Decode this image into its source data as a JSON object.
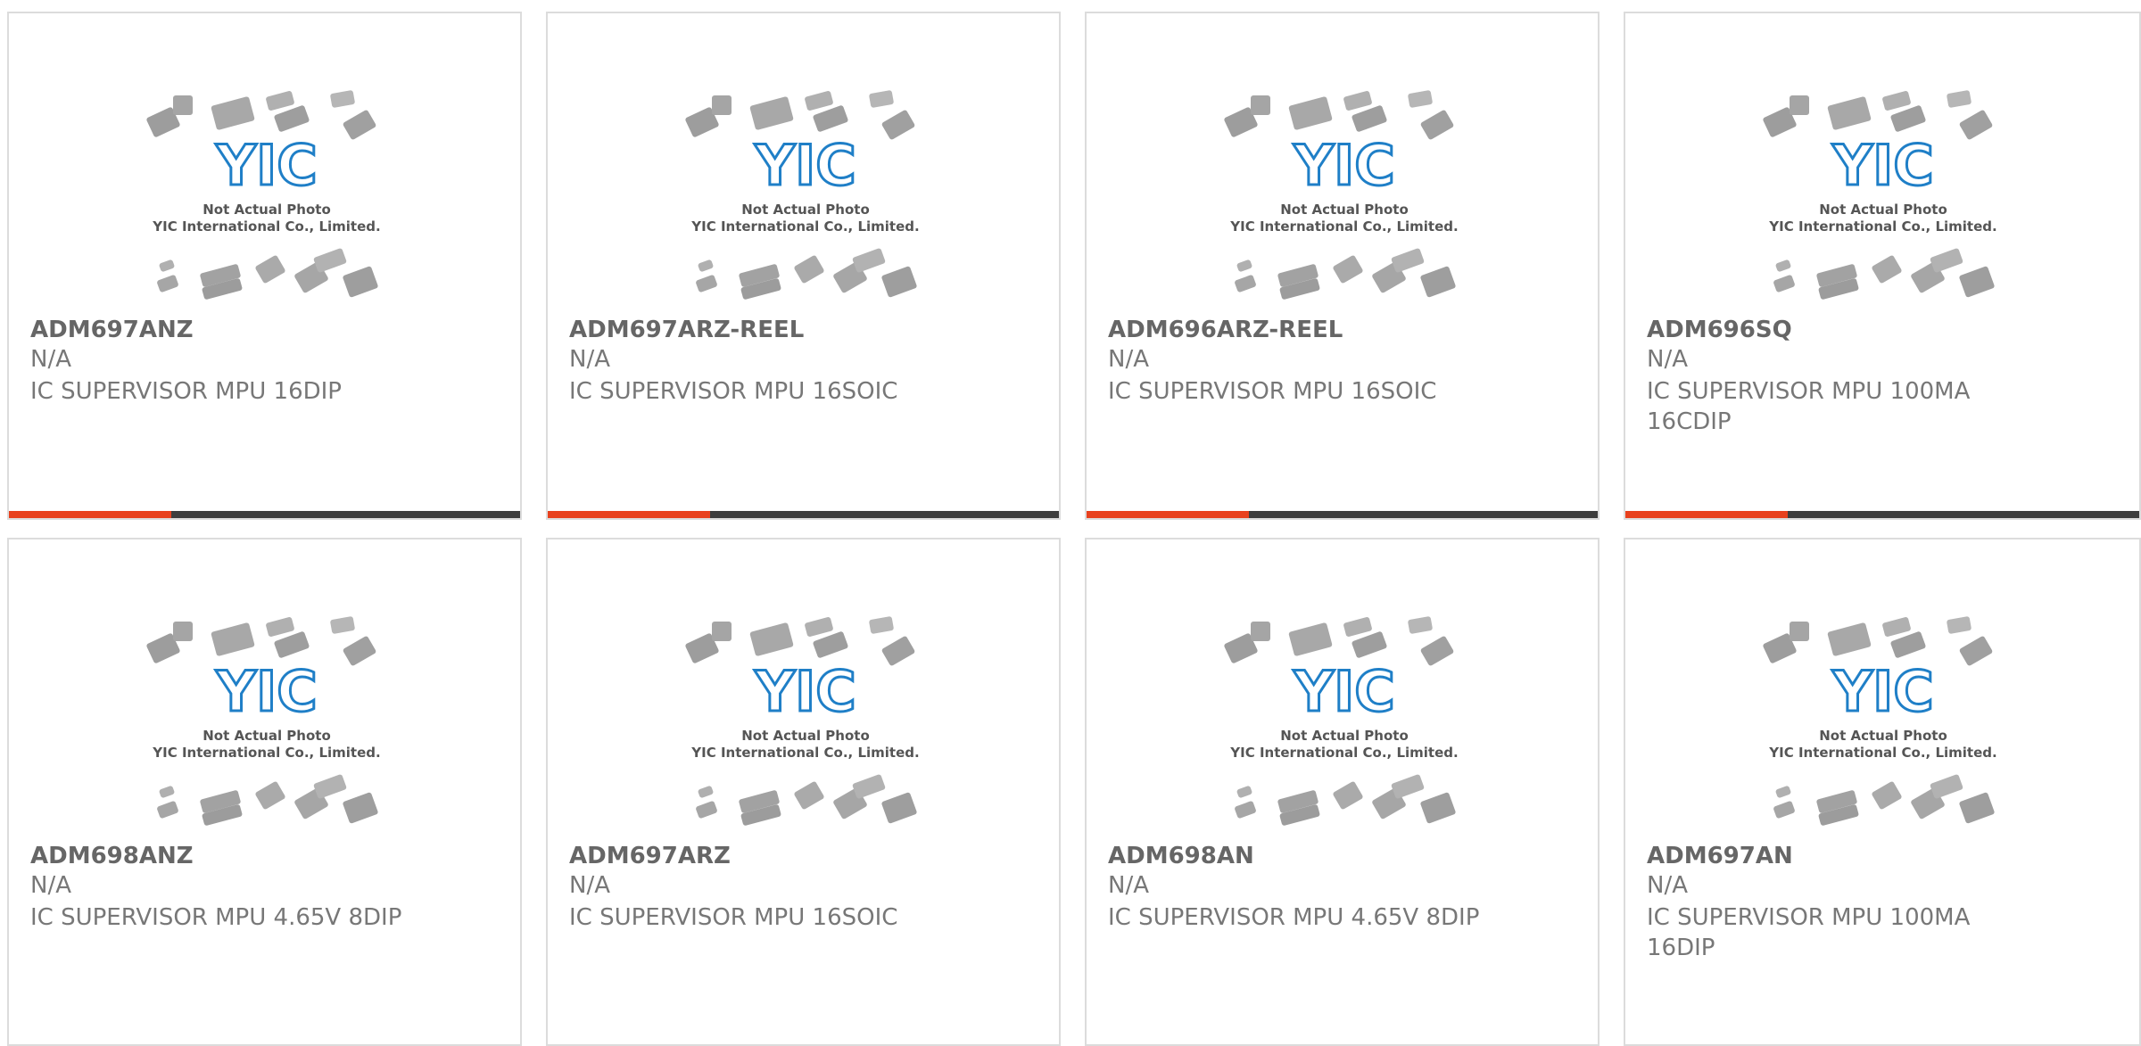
{
  "placeholder_image": {
    "caption_line1": "Not Actual Photo",
    "caption_line2": "YIC International Co., Limited.",
    "logo_text": "YIC",
    "logo_color": "#1f7fc7"
  },
  "colors": {
    "accent": "#e8411e",
    "bar_dark": "#3d3d3d",
    "border": "#dcdcdc",
    "text": "#777777"
  },
  "products": [
    {
      "part_number": "ADM697ANZ",
      "manufacturer": "N/A",
      "description": "IC SUPERVISOR MPU 16DIP"
    },
    {
      "part_number": "ADM697ARZ-REEL",
      "manufacturer": "N/A",
      "description": "IC SUPERVISOR MPU 16SOIC"
    },
    {
      "part_number": "ADM696ARZ-REEL",
      "manufacturer": "N/A",
      "description": "IC SUPERVISOR MPU 16SOIC"
    },
    {
      "part_number": "ADM696SQ",
      "manufacturer": "N/A",
      "description": "IC SUPERVISOR MPU 100MA 16CDIP"
    },
    {
      "part_number": "ADM698ANZ",
      "manufacturer": "N/A",
      "description": "IC SUPERVISOR MPU 4.65V 8DIP"
    },
    {
      "part_number": "ADM697ARZ",
      "manufacturer": "N/A",
      "description": "IC SUPERVISOR MPU 16SOIC"
    },
    {
      "part_number": "ADM698AN",
      "manufacturer": "N/A",
      "description": "IC SUPERVISOR MPU 4.65V 8DIP"
    },
    {
      "part_number": "ADM697AN",
      "manufacturer": "N/A",
      "description": "IC SUPERVISOR MPU 100MA 16DIP"
    }
  ]
}
